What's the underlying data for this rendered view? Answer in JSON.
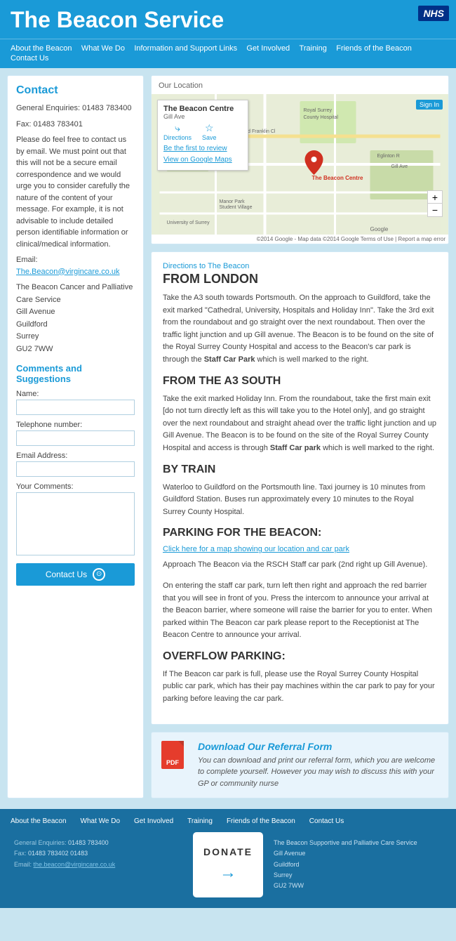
{
  "header": {
    "title": "The Beacon Service",
    "nhs_label": "NHS"
  },
  "nav": {
    "items": [
      {
        "label": "About the Beacon",
        "href": "#"
      },
      {
        "label": "What We Do",
        "href": "#"
      },
      {
        "label": "Information and Support Links",
        "href": "#"
      },
      {
        "label": "Get Involved",
        "href": "#"
      },
      {
        "label": "Training",
        "href": "#"
      },
      {
        "label": "Friends of the Beacon",
        "href": "#"
      },
      {
        "label": "Contact Us",
        "href": "#"
      }
    ]
  },
  "sidebar": {
    "heading": "Contact",
    "general_enquiries_label": "General Enquiries:",
    "general_enquiries_value": "01483 783400",
    "fax_label": "Fax:",
    "fax_value": "01483 783401",
    "email_text": "Please do feel free to contact us by email. We must point out that this will not be a secure email correspondence and we would urge you to consider carefully the nature of the content of your message. For example, it is not advisable to include detailed person identifiable information or clinical/medical information.",
    "email_label": "Email:",
    "email_value": "The.Beacon@virgincare.co.uk",
    "address_name": "The Beacon Cancer and Palliative Care Service",
    "address_street": "Gill Avenue",
    "address_city": "Guildford",
    "address_county": "Surrey",
    "address_postcode": "GU2 7WW",
    "comments_heading": "Comments and Suggestions",
    "form": {
      "name_label": "Name:",
      "name_placeholder": "",
      "telephone_label": "Telephone number:",
      "telephone_placeholder": "",
      "email_label": "Email Address:",
      "email_placeholder": "",
      "comments_label": "Your Comments:",
      "comments_placeholder": ""
    },
    "contact_button": "Contact Us"
  },
  "map_section": {
    "heading": "Our Location",
    "place_name": "The Beacon Centre",
    "place_address": "Gill Ave",
    "link_review": "Be the first to review",
    "link_maps": "View on Google Maps",
    "sign_in": "Sign In",
    "directions_btn": "Directions",
    "save_btn": "Save",
    "credit": "©2014 Google - Map data ©2014 Google   Terms of Use | Report a map error"
  },
  "directions": {
    "subtitle": "Directions to The Beacon",
    "heading1": "FROM LONDON",
    "text1": "Take the A3 south towards Portsmouth. On the approach to Guildford, take the exit marked \"Cathedral, University, Hospitals and Holiday Inn\". Take the 3rd exit from the roundabout and go straight over the next roundabout. Then over the traffic light junction and up Gill avenue. The Beacon is to be found on the site of the Royal Surrey County Hospital and access to the Beacon's car park is through the Staff Car Park which is well marked to the right.",
    "heading2": "FROM THE A3 SOUTH",
    "text2": "Take the exit marked Holiday Inn. From the roundabout, take the first main exit [do not turn directly left as this will take you to the Hotel only], and go straight over the next roundabout and straight ahead over the traffic light junction and up Gill Avenue. The Beacon is to be found on the site of the Royal Surrey County Hospital and access is through Staff Car park which is well marked to the right.",
    "heading3": "BY TRAIN",
    "text3": "Waterloo to Guildford on the Portsmouth line. Taxi journey is 10 minutes from Guildford Station. Buses run approximately every 10 minutes to the Royal Surrey County Hospital.",
    "heading4": "PARKING FOR THE BEACON:",
    "map_link": "Click here for a map showing our location and car park",
    "text4": "Approach The Beacon via the RSCH Staff car park (2nd right up Gill Avenue).",
    "text5": "On entering the staff car park, turn left then right and approach the red barrier that you will see in front of you. Press the intercom to announce your arrival at the Beacon barrier, where someone will raise the barrier for you to enter. When parked within The Beacon car park please report to the Receptionist at The Beacon Centre to announce your arrival.",
    "heading5": "OVERFLOW PARKING:",
    "text6": "If The Beacon car park is full, please use the Royal Surrey County Hospital public car park, which has their pay machines within the car park to pay for your parking before leaving the car park."
  },
  "referral": {
    "title": "Download Our Referral Form",
    "description": "You can download and print our referral form, which you are welcome to complete yourself. However you may wish to discuss this with your GP or community nurse"
  },
  "footer": {
    "nav": [
      {
        "label": "About the Beacon"
      },
      {
        "label": "What We Do"
      },
      {
        "label": "Get Involved"
      },
      {
        "label": "Training"
      },
      {
        "label": "Friends of the Beacon"
      },
      {
        "label": "Contact Us"
      }
    ],
    "col1": {
      "general_label": "General Enquiries:",
      "general_value": "01483 783400",
      "fax_label": "Fax:",
      "fax_value": "01483 783402 01483",
      "email_label": "Email:",
      "email_value": "the.beacon@virgincare.co.uk"
    },
    "donate": {
      "text": "DONATE",
      "arrow": "→"
    },
    "col2": {
      "name": "The Beacon Supportive and Palliative Care Service",
      "street": "Gill Avenue",
      "city": "Guildford",
      "county": "Surrey",
      "postcode": "GU2 7WW"
    }
  }
}
